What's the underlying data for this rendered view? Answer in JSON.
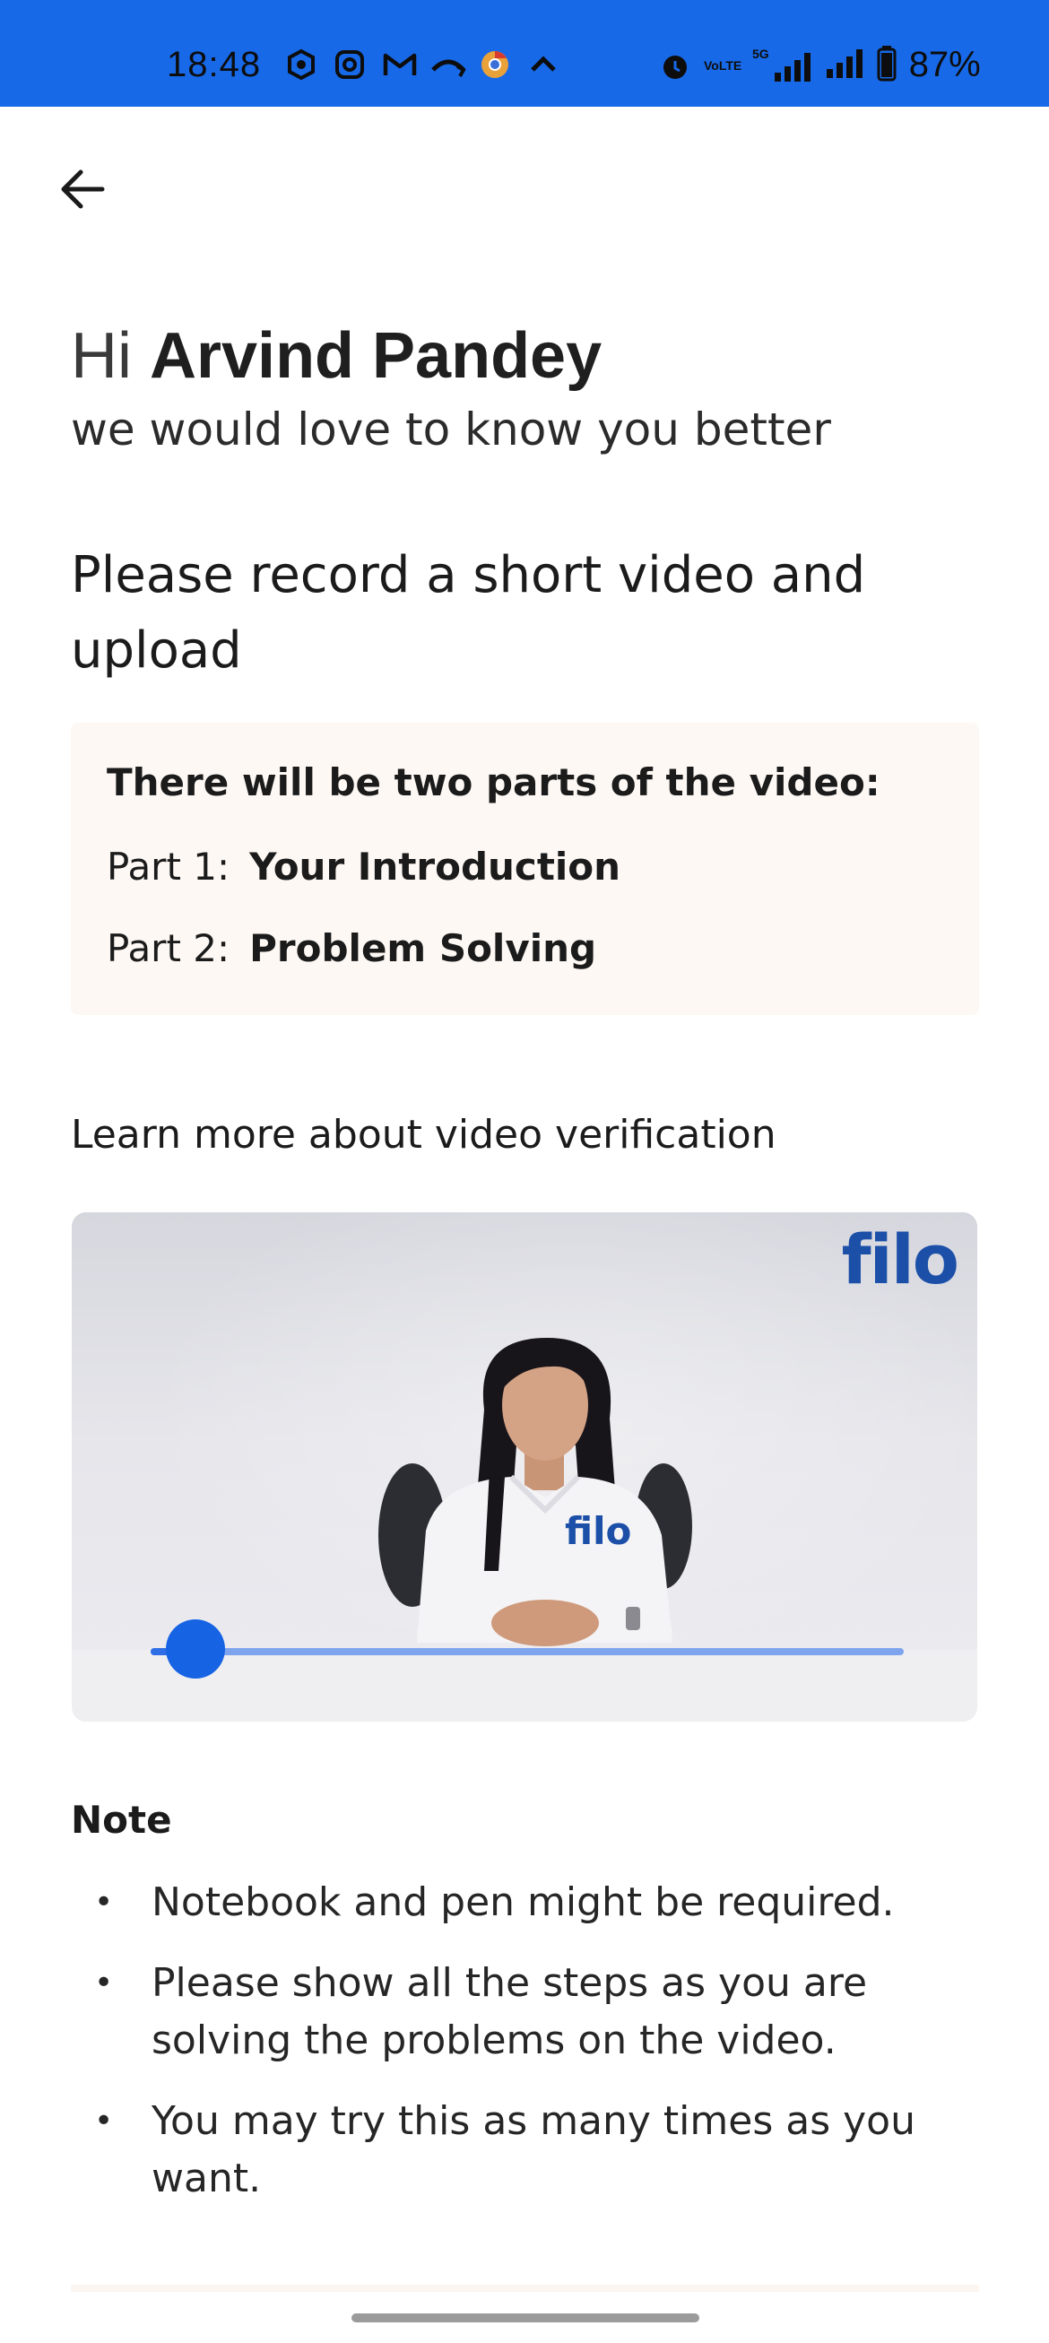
{
  "status_bar": {
    "time": "18:48",
    "battery": "87%",
    "volte": "VoLTE",
    "network": "5G",
    "icons_left": [
      "app-icon",
      "instagram-icon",
      "gmail-icon",
      "missed-call-icon",
      "chrome-icon",
      "chevron-up-icon"
    ],
    "icons_right": [
      "alarm-icon",
      "volte-icon",
      "signal-5g-icon",
      "signal-icon",
      "battery-icon"
    ],
    "background": "#1769e8"
  },
  "header": {
    "back_icon": "arrow-left-icon"
  },
  "greeting": {
    "hi": "Hi ",
    "name": "Arvind Pandey",
    "subtitle": "we would love to know you better"
  },
  "heading": "Please record a short video and upload",
  "parts": {
    "title": "There will be two parts of the video:",
    "items": [
      {
        "label": "Part 1:",
        "value": "Your Introduction"
      },
      {
        "label": "Part 2:",
        "value": "Problem Solving"
      }
    ]
  },
  "learn_more": "Learn more about video verification",
  "video": {
    "logo": "filo",
    "shirt_logo": "filo",
    "progress": 0.06,
    "accent": "#1663e4"
  },
  "note": {
    "title": "Note",
    "items": [
      "Notebook and pen might be required.",
      "Please show all the steps as you are solving the problems on the video.",
      "You may try this as many times as you want."
    ]
  }
}
